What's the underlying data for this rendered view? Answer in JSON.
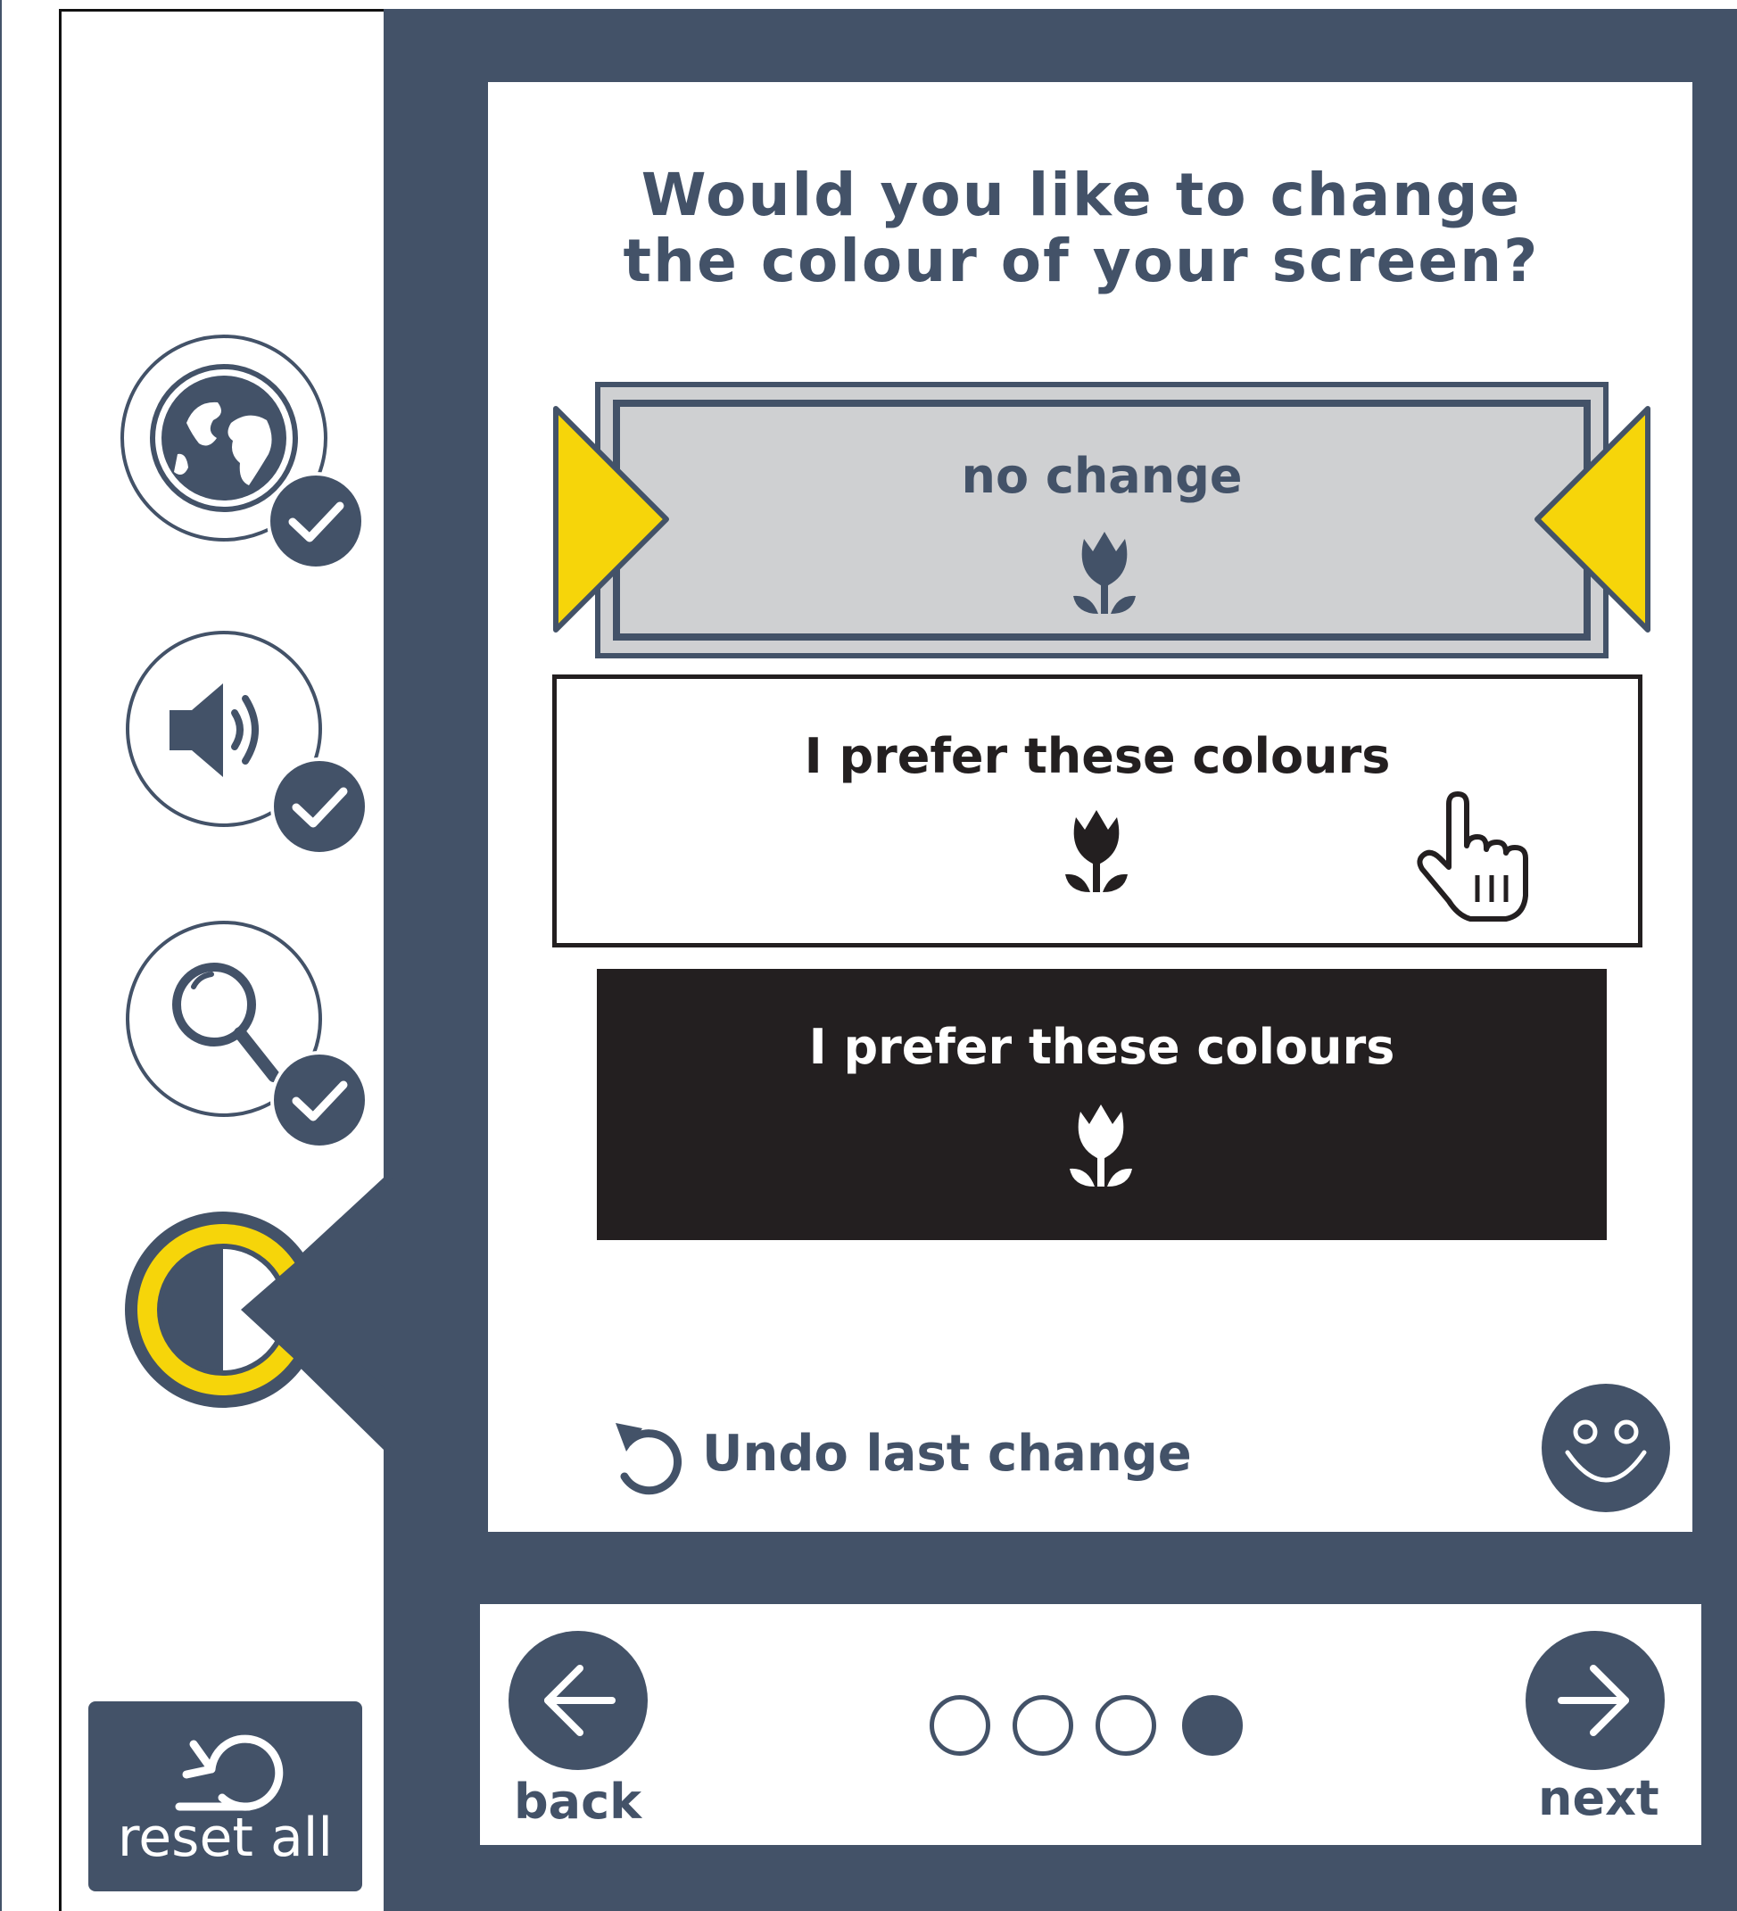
{
  "question": {
    "line1": "Would you like to change",
    "line2": "the colour of your screen?"
  },
  "options": [
    {
      "label": "no change",
      "selected": true,
      "style": "default"
    },
    {
      "label": "I prefer these colours",
      "selected": false,
      "style": "black-on-white"
    },
    {
      "label": "I prefer these colours",
      "selected": false,
      "style": "white-on-black"
    }
  ],
  "undo_label": "Undo last change",
  "nav": {
    "back_label": "back",
    "next_label": "next",
    "total_steps": 4,
    "current_step": 4
  },
  "reset_label": "reset all",
  "sidebar_steps": [
    {
      "icon": "globe-icon",
      "completed": true
    },
    {
      "icon": "speaker-icon",
      "completed": true
    },
    {
      "icon": "magnifier-icon",
      "completed": true
    },
    {
      "icon": "contrast-icon",
      "completed": false,
      "active": true
    }
  ],
  "colors": {
    "primary": "#435268",
    "accent": "#f6d50a",
    "selected_fill": "#cfd0d2",
    "black_option": "#231f20"
  }
}
